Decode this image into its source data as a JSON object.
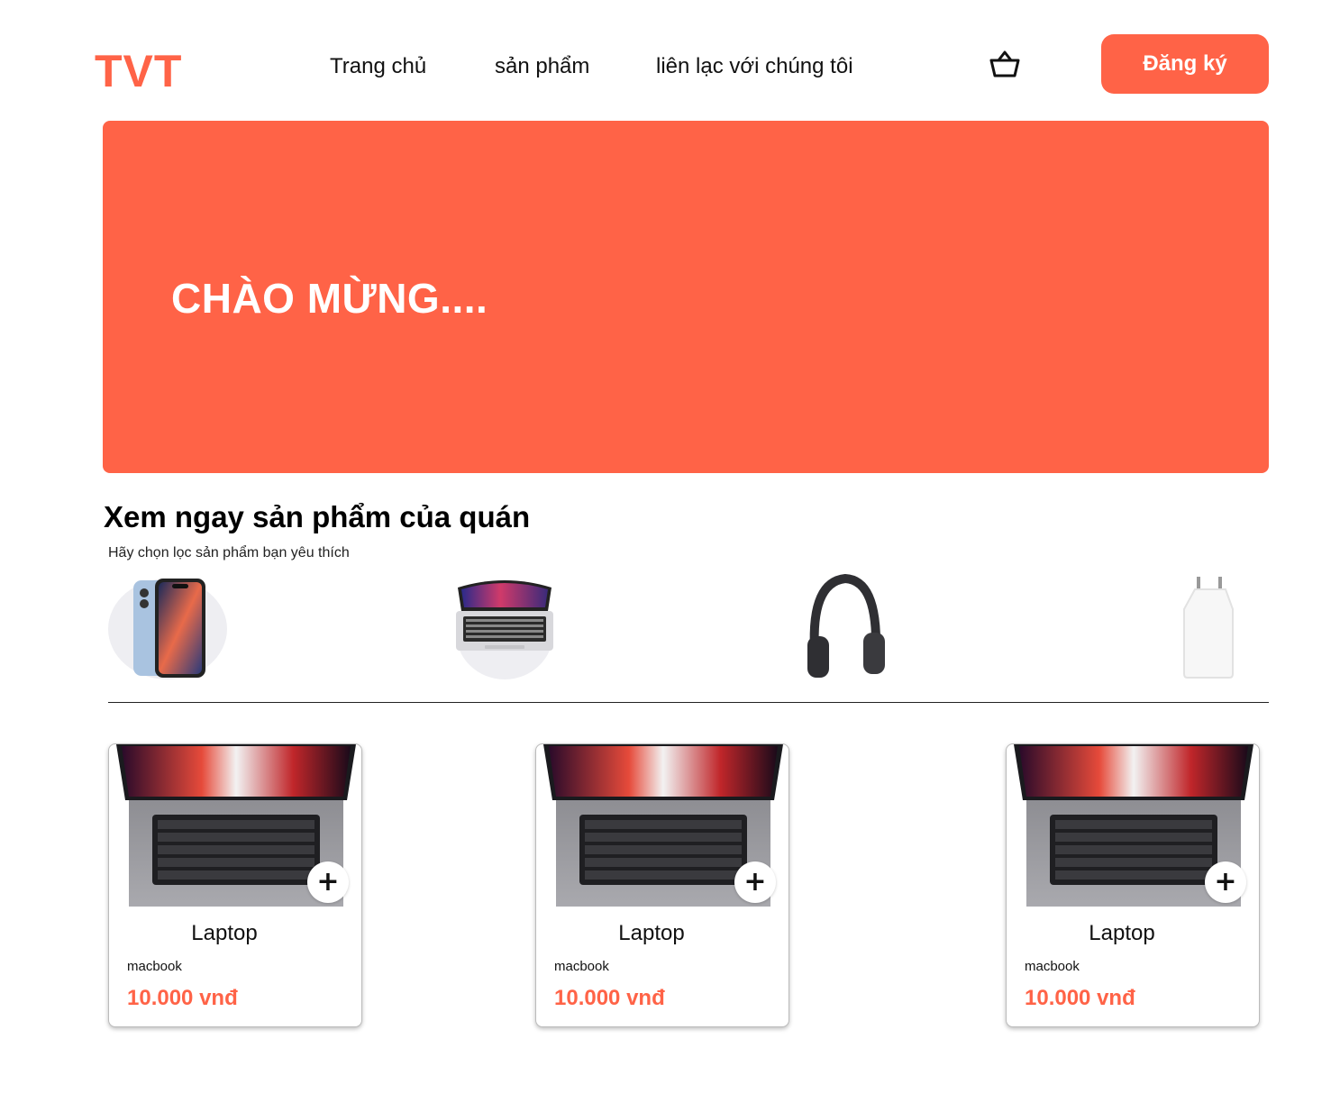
{
  "brand": {
    "logo": "TVT",
    "accent": "#ff6347"
  },
  "nav": {
    "items": [
      "Trang chủ",
      "sản phẩm",
      "liên lạc với chúng tôi"
    ]
  },
  "header": {
    "cart_icon": "basket-icon",
    "signup_label": "Đăng ký"
  },
  "hero": {
    "title": "CHÀO MỪNG...."
  },
  "section": {
    "title": "Xem ngay sản phẩm của quán",
    "subtitle": "Hãy chọn lọc sản phẩm bạn yêu thích"
  },
  "categories": [
    {
      "icon": "phone-icon"
    },
    {
      "icon": "laptop-icon"
    },
    {
      "icon": "headphones-icon"
    },
    {
      "icon": "charger-icon"
    }
  ],
  "products": [
    {
      "name": "Laptop",
      "subtitle": "macbook",
      "price": "10.000 vnđ",
      "add_icon": "plus-icon"
    },
    {
      "name": "Laptop",
      "subtitle": "macbook",
      "price": "10.000 vnđ",
      "add_icon": "plus-icon"
    },
    {
      "name": "Laptop",
      "subtitle": "macbook",
      "price": "10.000 vnđ",
      "add_icon": "plus-icon"
    }
  ]
}
